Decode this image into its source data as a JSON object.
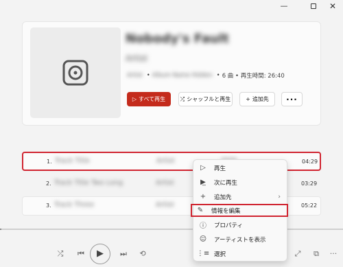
{
  "window": {
    "minimize": "—",
    "maximize": "",
    "close": "✕"
  },
  "album": {
    "title": "Nobody's Fault",
    "artist": "Artist",
    "meta_artist": "Artist",
    "meta_album": "Album Name Hidden",
    "meta_rest": "6 曲 • 再生時間: 26:40",
    "cover_icon": "disc-icon"
  },
  "buttons": {
    "play_all": "すべて再生",
    "shuffle": "シャッフルと再生",
    "add_to": "追加先",
    "more": "···"
  },
  "tracks": [
    {
      "num": "1.",
      "title": "Track Title",
      "artist": "Artist",
      "extra": "2020",
      "duration": "04:29"
    },
    {
      "num": "2.",
      "title": "Track Title Two Long",
      "artist": "Artist",
      "extra": "",
      "duration": "03:29"
    },
    {
      "num": "3.",
      "title": "Track Three",
      "artist": "Artist",
      "extra": "",
      "duration": "05:22"
    }
  ],
  "context_menu": [
    {
      "label": "再生",
      "icon": "play-icon"
    },
    {
      "label": "次に再生",
      "icon": "play-next-icon"
    },
    {
      "label": "追加先",
      "icon": "plus-icon",
      "has_submenu": true
    },
    {
      "label": "情報を編集",
      "icon": "pencil-icon"
    },
    {
      "label": "プロパティ",
      "icon": "info-icon"
    },
    {
      "label": "アーティストを表示",
      "icon": "person-icon"
    },
    {
      "label": "選択",
      "icon": "select-icon"
    }
  ],
  "player": {
    "shuffle": "⤮",
    "prev": "⏮",
    "play": "▶",
    "next": "⏭",
    "repeat": "⟲",
    "expand": "⤢",
    "mini": "⧉",
    "more": "···"
  }
}
